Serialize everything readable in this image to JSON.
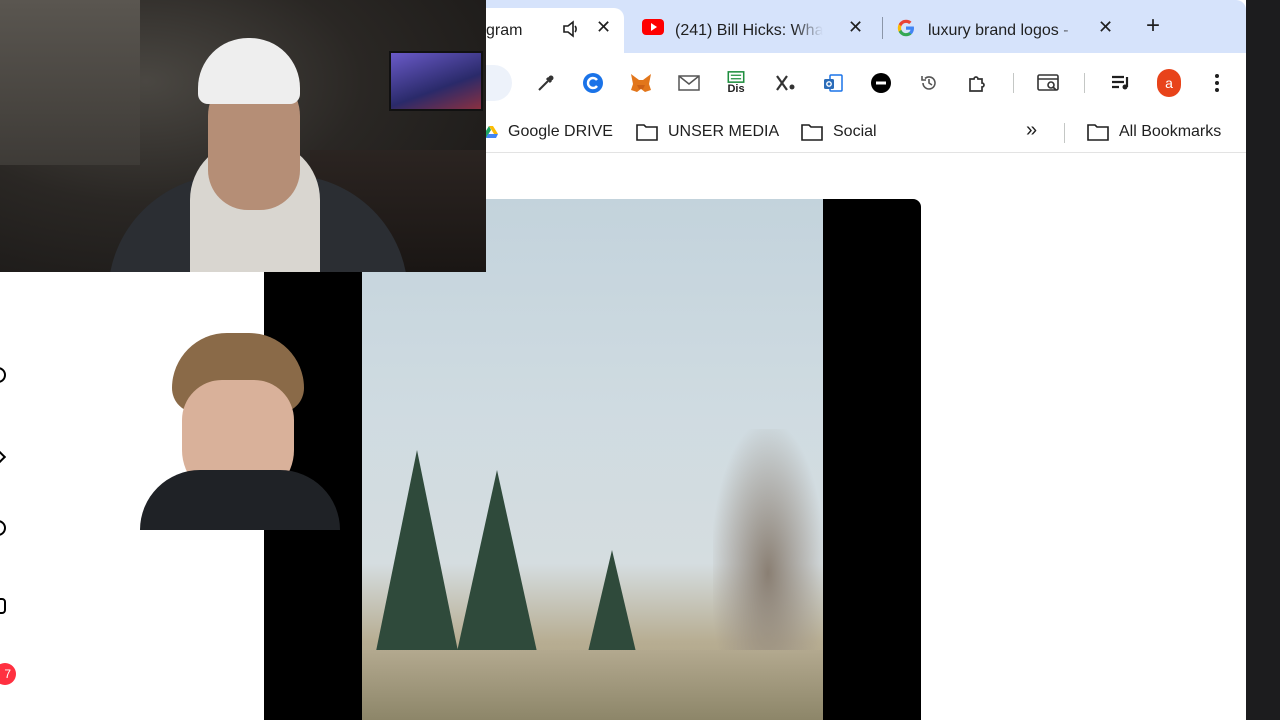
{
  "tabs": {
    "active": {
      "title": "gram"
    },
    "youtube": {
      "title": "(241) Bill Hicks: What"
    },
    "google": {
      "title": "luxury brand logos -"
    },
    "new_tab_label": "+"
  },
  "toolbar": {
    "extension_badge_text": "Dis",
    "profile_initial": "a"
  },
  "bookmarks": {
    "items": [
      {
        "label": "Google DRIVE"
      },
      {
        "label": "UNSER MEDIA"
      },
      {
        "label": "Social"
      }
    ],
    "overflow_label": "»",
    "all_bookmarks_label": "All Bookmarks"
  },
  "sidebar": {
    "notification_count": "7"
  },
  "colors": {
    "tab_strip": "#d6e3fb",
    "youtube_red": "#ff0000",
    "profile_avatar": "#e8431a",
    "notification_badge": "#ff3040"
  },
  "icons": {
    "tab_audio": "speaker-icon",
    "tab_close": "close-icon",
    "youtube_favicon": "youtube-icon",
    "google_favicon": "google-g-icon",
    "drive_favicon": "google-drive-icon",
    "folder": "folder-icon"
  }
}
